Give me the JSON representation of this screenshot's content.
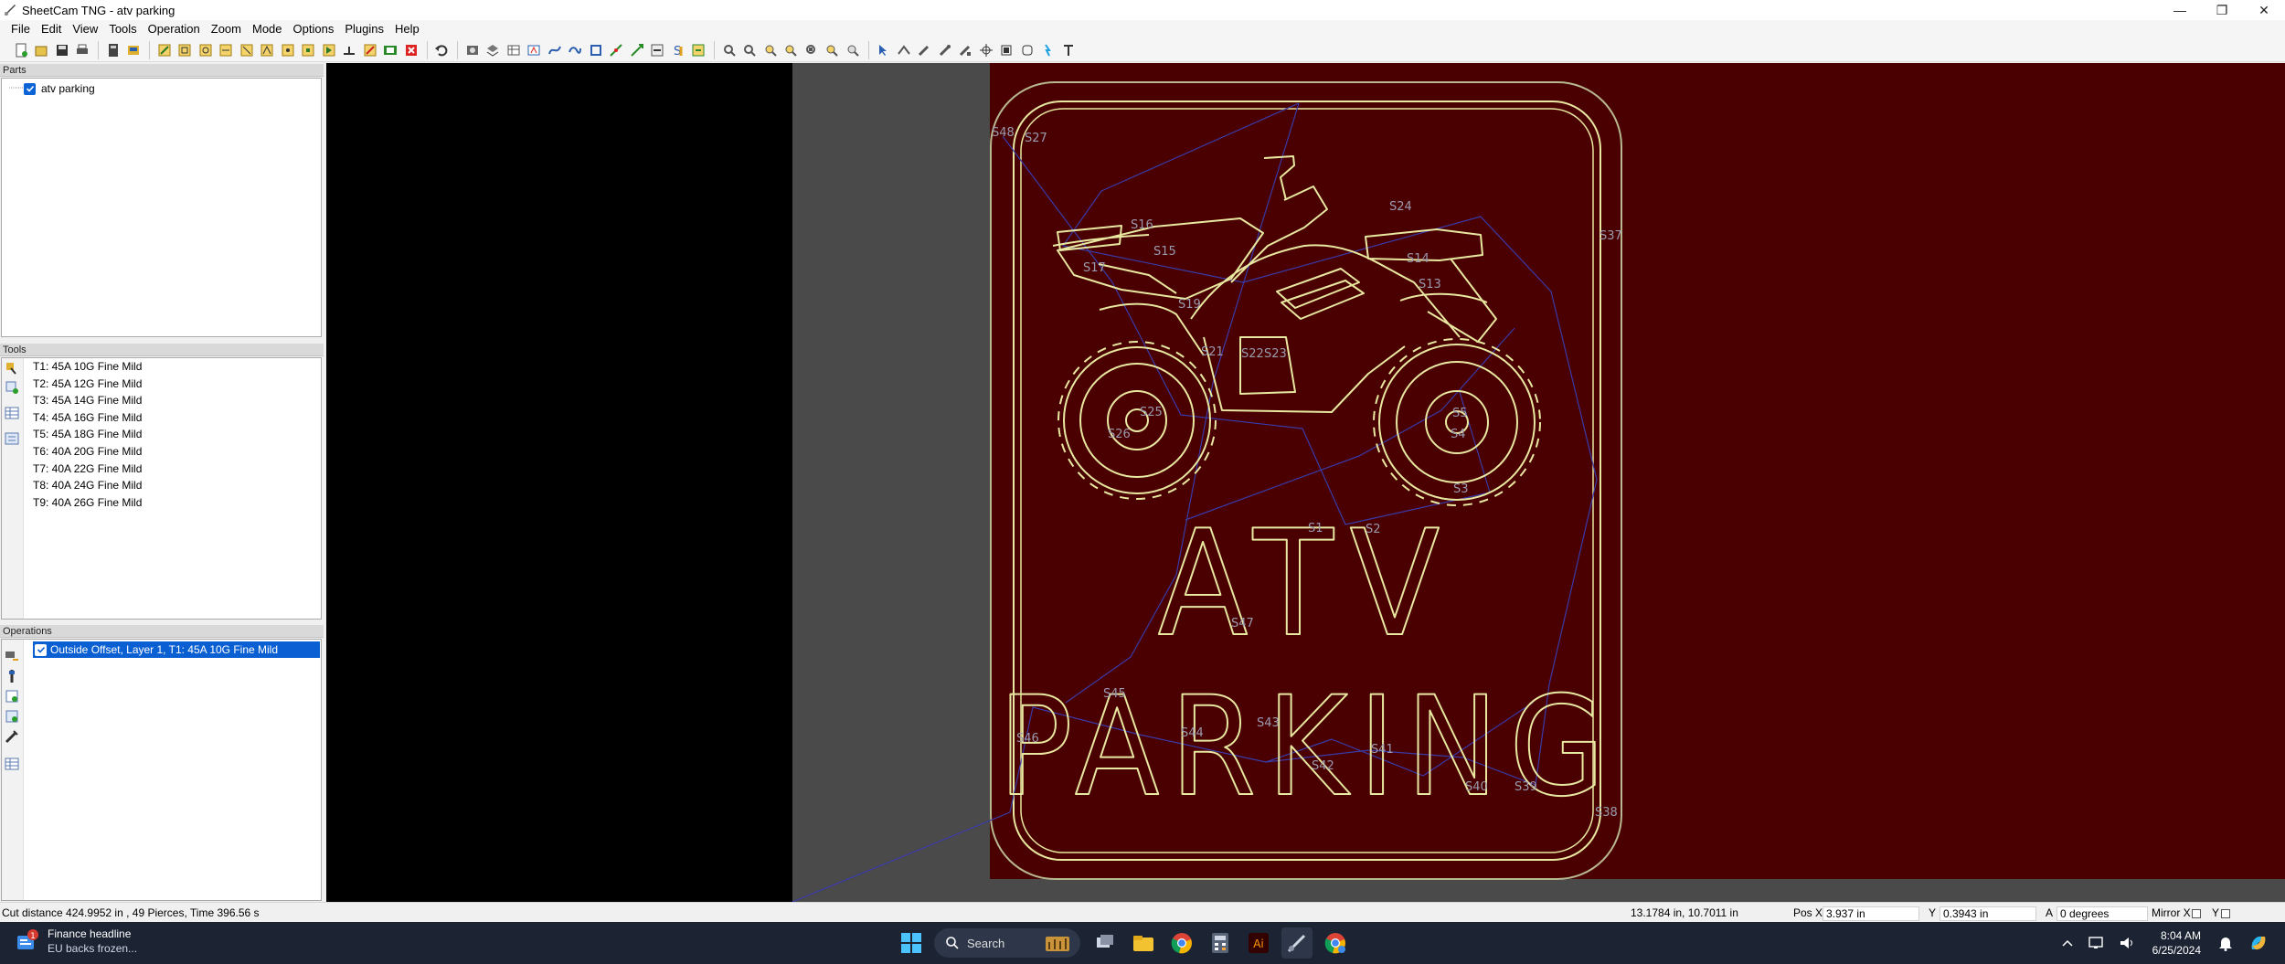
{
  "window": {
    "title": "SheetCam TNG - atv parking",
    "controls": [
      "minimize-icon",
      "restore-icon",
      "close-icon"
    ]
  },
  "menu": [
    "File",
    "Edit",
    "View",
    "Tools",
    "Operation",
    "Zoom",
    "Mode",
    "Options",
    "Plugins",
    "Help"
  ],
  "panels": {
    "parts": {
      "header": "Parts",
      "items": [
        {
          "label": "atv parking",
          "checked": true
        }
      ]
    },
    "tools": {
      "header": "Tools",
      "items": [
        "T1: 45A 10G Fine Mild",
        "T2: 45A 12G Fine Mild",
        "T3: 45A 14G Fine Mild",
        "T4: 45A 16G Fine Mild",
        "T5: 45A 18G Fine Mild",
        "T6: 40A 20G Fine Mild",
        "T7: 40A 22G Fine Mild",
        "T8: 40A 24G Fine Mild",
        "T9: 40A 26G Fine Mild"
      ]
    },
    "operations": {
      "header": "Operations",
      "items": [
        {
          "label": "Outside Offset, Layer 1, T1: 45A 10G Fine Mild",
          "checked": true,
          "selected": true
        }
      ]
    }
  },
  "canvas": {
    "sign_text_line1": "ATV",
    "sign_text_line2": "PARKING",
    "part_background_color": "#4a0000",
    "stock_color": "#4a4a4a",
    "path_color": "#e8e8a0",
    "rapid_color": "#3a3aa8",
    "labels": [
      "S48",
      "S27",
      "S16",
      "S15",
      "S17",
      "S19",
      "S24",
      "S14",
      "S13",
      "S37",
      "S25",
      "S26",
      "S21",
      "S22",
      "S23",
      "S5",
      "S4",
      "S3",
      "S1",
      "S2",
      "S47",
      "S45",
      "S44",
      "S43",
      "S42",
      "S41",
      "S46",
      "S40",
      "S39",
      "S38"
    ]
  },
  "status": {
    "summary": "Cut distance 424.9952 in , 49 Pierces, Time 396.56 s",
    "dims": "13.1784 in, 10.7011 in",
    "pos_x_label": "Pos X",
    "pos_x": "3.937 in",
    "y_label": "Y",
    "pos_y": "0.3943 in",
    "a_label": "A",
    "angle": "0 degrees",
    "mirror_x": "Mirror X",
    "mirror_y": "Y"
  },
  "taskbar": {
    "news_title": "Finance headline",
    "news_sub": "EU backs frozen...",
    "news_badge": "1",
    "search_placeholder": "Search",
    "time": "8:04 AM",
    "date": "6/25/2024"
  }
}
